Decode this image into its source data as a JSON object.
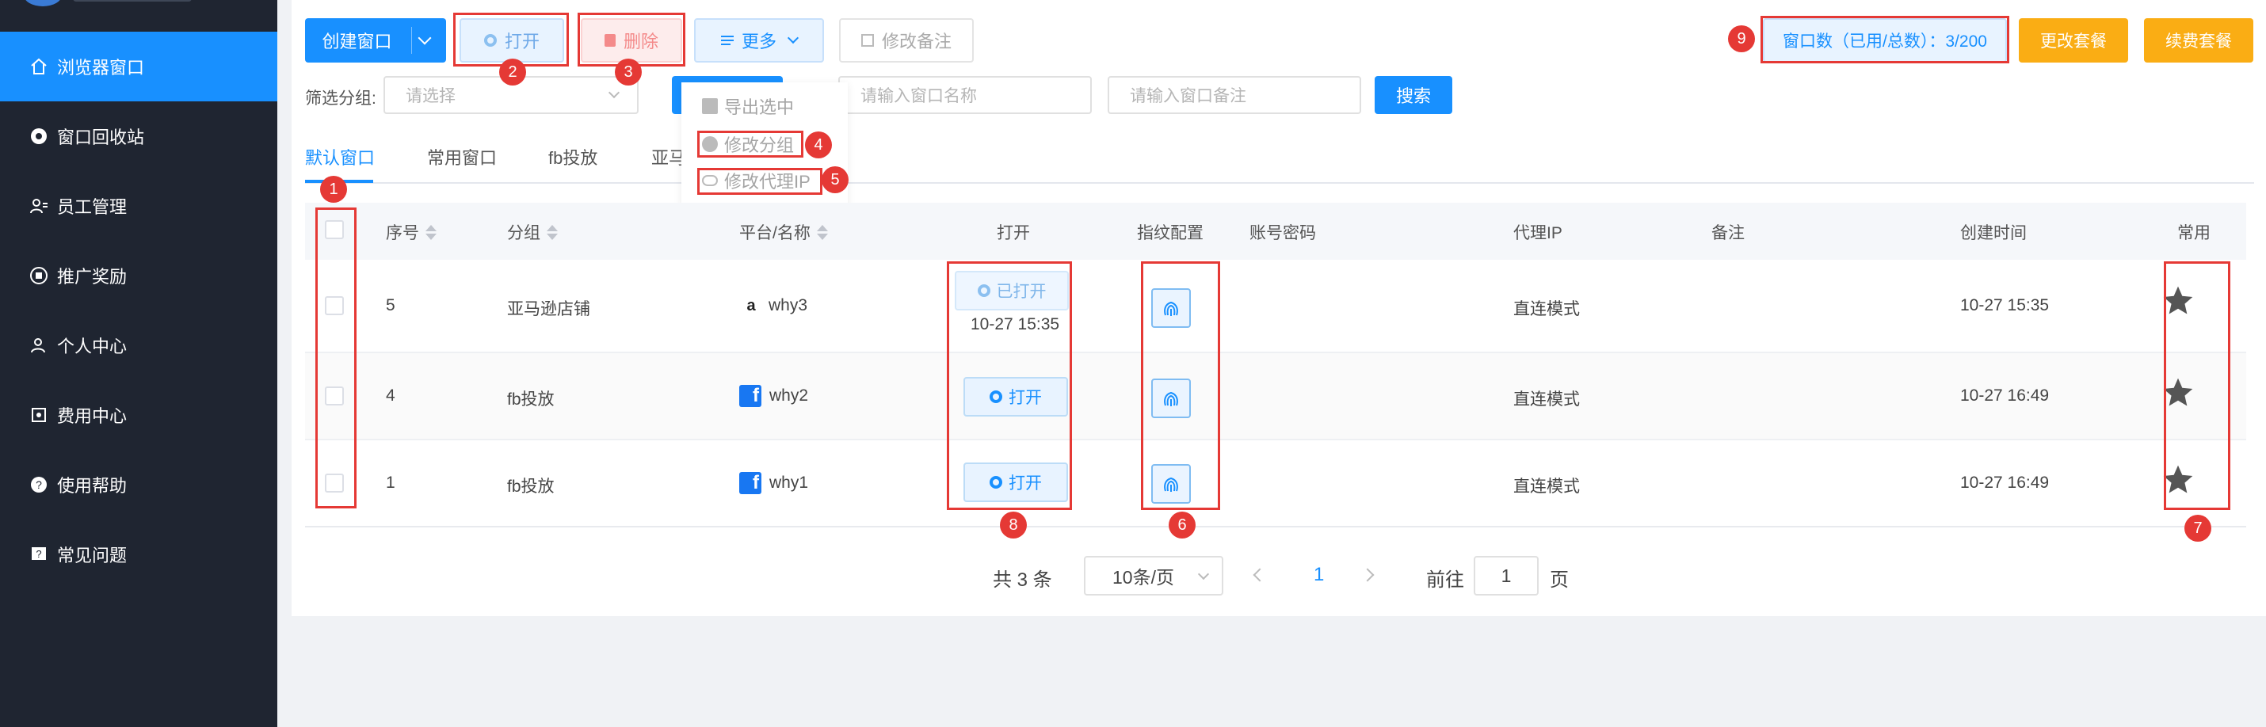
{
  "sidebar": {
    "items": [
      {
        "label": "浏览器窗口",
        "icon": "home-icon"
      },
      {
        "label": "窗口回收站",
        "icon": "chrome-icon"
      },
      {
        "label": "员工管理",
        "icon": "users-icon"
      },
      {
        "label": "推广奖励",
        "icon": "gift-icon"
      },
      {
        "label": "个人中心",
        "icon": "user-icon"
      },
      {
        "label": "费用中心",
        "icon": "wallet-icon"
      },
      {
        "label": "使用帮助",
        "icon": "help-icon"
      },
      {
        "label": "常见问题",
        "icon": "question-icon"
      }
    ]
  },
  "toolbar": {
    "create_label": "创建窗口",
    "open_label": "打开",
    "delete_label": "删除",
    "more_label": "更多",
    "remark_label": "修改备注",
    "window_count": "窗口数（已用/总数）：3/200",
    "change_plan": "更改套餐",
    "renew_plan": "续费套餐"
  },
  "filter": {
    "group_label": "筛选分组:",
    "group_placeholder": "请选择",
    "name_placeholder": "请输入窗口名称",
    "remark_placeholder": "请输入窗口备注",
    "search_label": "搜索"
  },
  "more_menu": {
    "items": [
      "导出选中",
      "修改分组",
      "修改代理IP"
    ]
  },
  "tabs": [
    "默认窗口",
    "常用窗口",
    "fb投放",
    "亚马"
  ],
  "table": {
    "headers": {
      "index": "序号",
      "group": "分组",
      "platform": "平台/名称",
      "open": "打开",
      "fingerprint": "指纹配置",
      "account": "账号密码",
      "proxy": "代理IP",
      "remark": "备注",
      "created": "创建时间",
      "favorite": "常用"
    },
    "rows": [
      {
        "index": "5",
        "group": "亚马逊店铺",
        "platform": "amazon",
        "name": "why3",
        "open_label": "已打开",
        "open_time": "10-27 15:35",
        "proxy": "直连模式",
        "created": "10-27 15:35"
      },
      {
        "index": "4",
        "group": "fb投放",
        "platform": "facebook",
        "name": "why2",
        "open_label": "打开",
        "proxy": "直连模式",
        "created": "10-27 16:49"
      },
      {
        "index": "1",
        "group": "fb投放",
        "platform": "facebook",
        "name": "why1",
        "open_label": "打开",
        "proxy": "直连模式",
        "created": "10-27 16:49"
      }
    ]
  },
  "pagination": {
    "total": "共 3 条",
    "page_size": "10条/页",
    "current": "1",
    "goto_label": "前往",
    "goto_value": "1",
    "page_suffix": "页"
  },
  "annotations": [
    "1",
    "2",
    "3",
    "4",
    "5",
    "6",
    "7",
    "8",
    "9"
  ],
  "colors": {
    "primary": "#1890ff",
    "sidebar": "#1f2531",
    "warn": "#faad14",
    "marker": "#e53935"
  }
}
